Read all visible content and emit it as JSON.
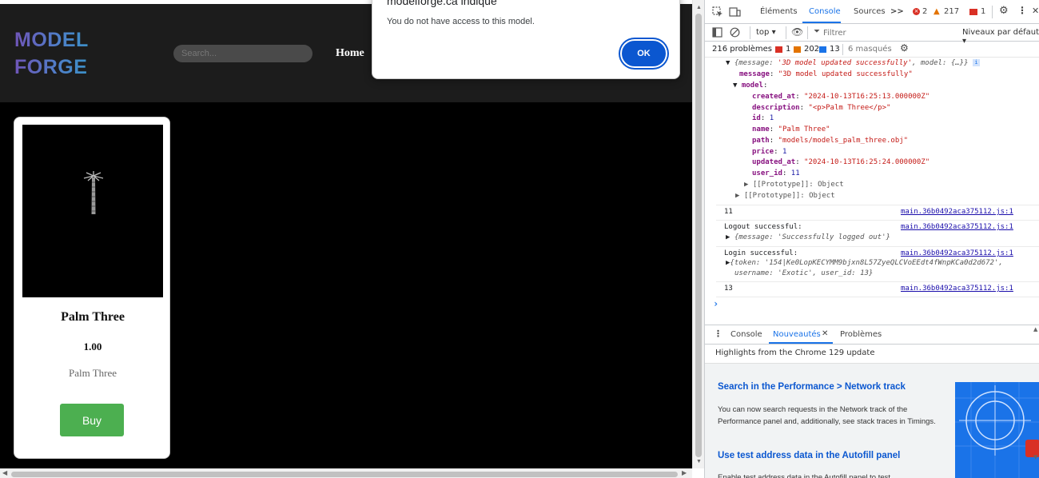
{
  "site": {
    "logo_line1": "MODEL",
    "logo_line2": "FORGE",
    "search_placeholder": "Search...",
    "nav_home": "Home",
    "product": {
      "title": "Palm Three",
      "price": "1.00",
      "description": "Palm Three",
      "buy_label": "Buy"
    }
  },
  "alert": {
    "title": "modelforge.ca indique",
    "message": "You do not have access to this model.",
    "ok_label": "OK"
  },
  "devtools": {
    "tabs": {
      "elements": "Éléments",
      "console": "Console",
      "sources": "Sources",
      "more": ">>",
      "errors": "2",
      "warnings": "217",
      "issues": "1"
    },
    "toolbar": {
      "context": "top ▾",
      "filter_placeholder": "Filtrer",
      "levels": "Niveaux par défaut ▾"
    },
    "issues_bar": {
      "label": "216 problèmes :",
      "errors": "1",
      "warnings": "202",
      "info": "13",
      "hidden": "6 masqués"
    },
    "console": {
      "obj_summary_key": "message",
      "obj_summary_val": "'3D model updated successfully'",
      "obj_summary_model": "model",
      "obj_summary_rest": "{…}}",
      "message_key": "message",
      "message_val": "\"3D model updated successfully\"",
      "model_key": "model",
      "fields": [
        {
          "k": "created_at",
          "v": "\"2024-10-13T16:25:13.000000Z\"",
          "t": "s"
        },
        {
          "k": "description",
          "v": "\"<p>Palm Three</p>\"",
          "t": "s"
        },
        {
          "k": "id",
          "v": "1",
          "t": "n"
        },
        {
          "k": "name",
          "v": "\"Palm Three\"",
          "t": "s"
        },
        {
          "k": "path",
          "v": "\"models/models_palm_three.obj\"",
          "t": "s"
        },
        {
          "k": "price",
          "v": "1",
          "t": "n"
        },
        {
          "k": "updated_at",
          "v": "\"2024-10-13T16:25:24.000000Z\"",
          "t": "s"
        },
        {
          "k": "user_id",
          "v": "11",
          "t": "n"
        }
      ],
      "proto_inner": "[[Prototype]]: Object",
      "proto_outer": "[[Prototype]]: Object",
      "log_11": "11",
      "source": "main.36b0492aca375112.js:1",
      "logout_label": "Logout successful:",
      "logout_obj": "{message: 'Successfully logged out'}",
      "login_label": "Login successful:",
      "login_obj_line1": "{token: '154|Ke0LopKECYMM9bjxn8L57ZyeQLCVoEEdt4fWnpKCa0d2d672',",
      "login_obj_line2": "username: 'Exotic', user_id: 13}",
      "log_13": "13",
      "prompt": "›"
    },
    "drawer": {
      "tab_console": "Console",
      "tab_whats_new": "Nouveautés",
      "tab_problems": "Problèmes",
      "highlights": "Highlights from the Chrome 129 update",
      "h1": "Search in the Performance > Network track",
      "p1": "You can now search requests in the Network track of the Performance panel and, additionally, see stack traces in Timings.",
      "h2": "Use test address data in the Autofill panel",
      "p2": "Enable test address data in the Autofill panel to test"
    }
  }
}
